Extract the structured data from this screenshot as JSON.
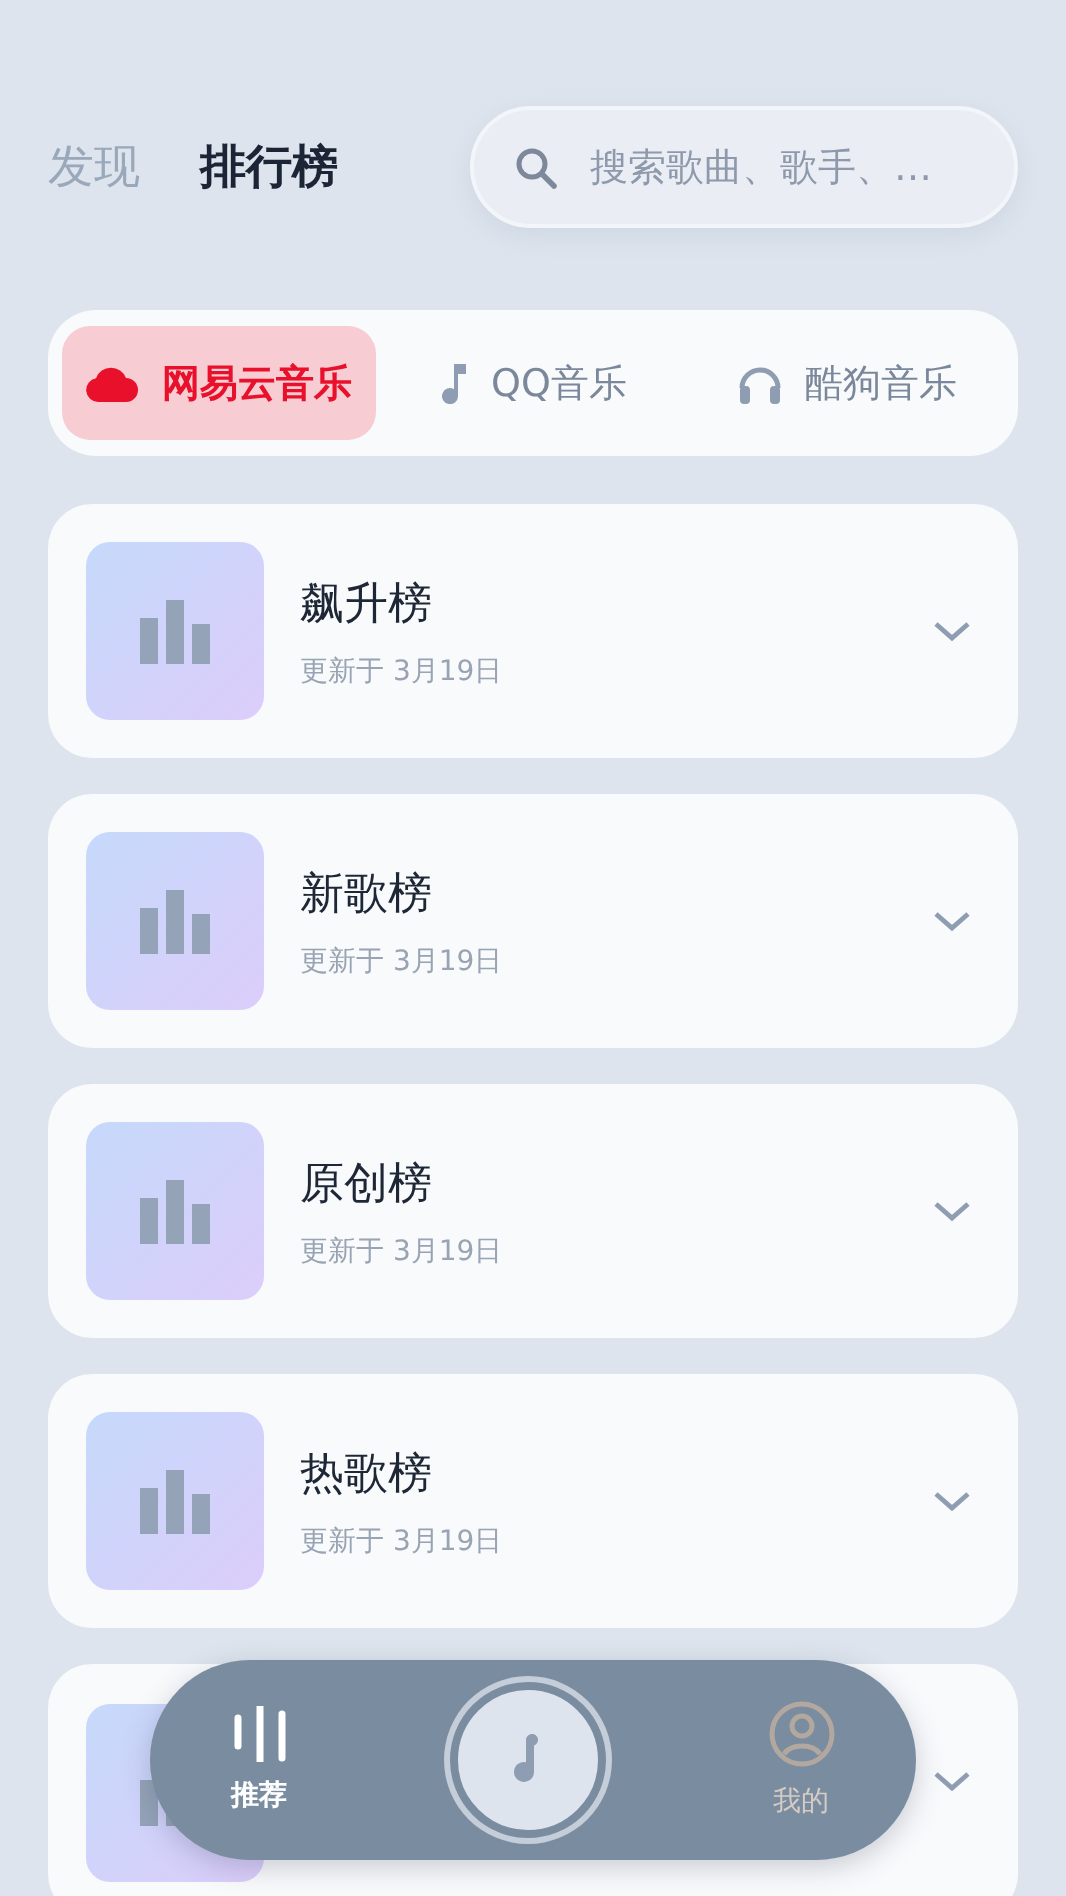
{
  "header_tabs": [
    {
      "label": "发现",
      "selected": false
    },
    {
      "label": "排行榜",
      "selected": true
    }
  ],
  "search": {
    "placeholder": "搜索歌曲、歌手、…"
  },
  "sources": [
    {
      "label": "网易云音乐",
      "kind": "cloud",
      "selected": true
    },
    {
      "label": "QQ音乐",
      "kind": "note",
      "selected": false
    },
    {
      "label": "酷狗音乐",
      "kind": "headphones",
      "selected": false
    }
  ],
  "charts": [
    {
      "title": "飙升榜",
      "updated": "更新于 3月19日"
    },
    {
      "title": "新歌榜",
      "updated": "更新于 3月19日"
    },
    {
      "title": "原创榜",
      "updated": "更新于 3月19日"
    },
    {
      "title": "热歌榜",
      "updated": "更新于 3月19日"
    },
    {
      "kind": "covered"
    }
  ],
  "bottom_nav": [
    {
      "label": "推荐",
      "kind": "bars",
      "selected": true
    },
    {
      "kind": "player"
    },
    {
      "label": "我的",
      "kind": "user",
      "selected": false
    }
  ]
}
